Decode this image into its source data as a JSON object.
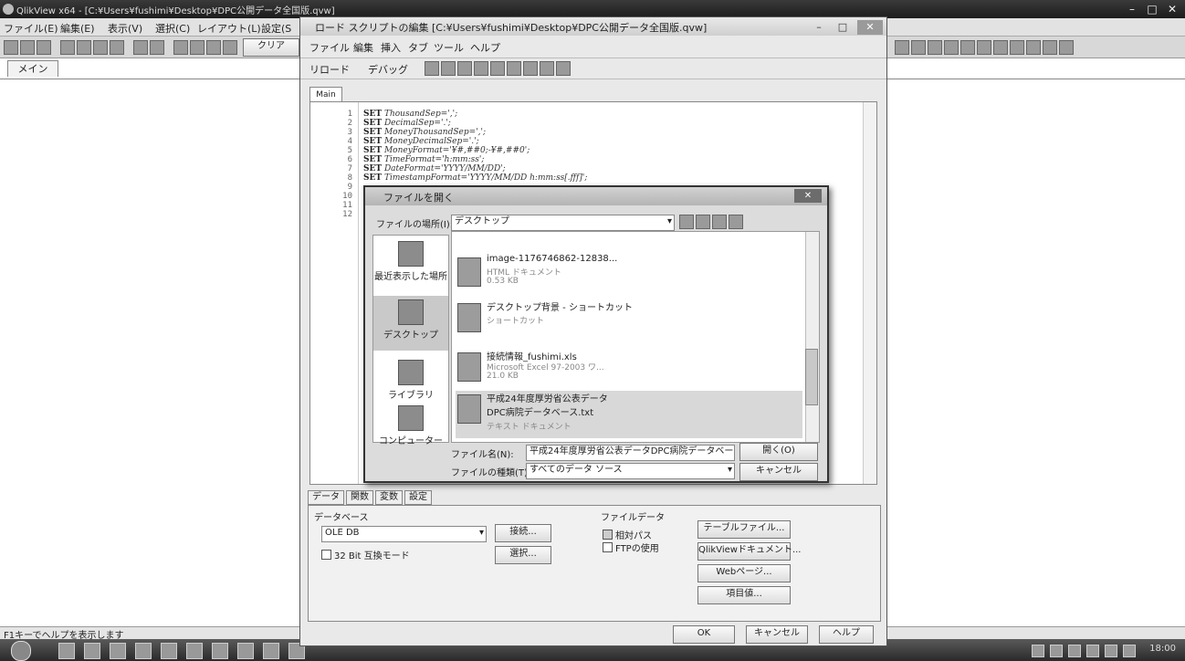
{
  "main_window": {
    "title": "QlikView x64 - [C:¥Users¥fushimi¥Desktop¥DPC公開データ全国版.qvw]",
    "menu": [
      "ファイル(E)",
      "編集(E)",
      "表示(V)",
      "選択(C)",
      "レイアウト(L)",
      "設定(S"
    ],
    "clear_label": "クリア",
    "sheet_tab": "メイン",
    "status_text": "F1キーでヘルプを表示します",
    "clock": "18:00"
  },
  "editor": {
    "title": "ロード スクリプトの編集 [C:¥Users¥fushimi¥Desktop¥DPC公開データ全国版.qvw]",
    "menu": [
      "ファイル",
      "編集",
      "挿入",
      "タブ",
      "ツール",
      "ヘルプ"
    ],
    "reload": "リロード",
    "debug": "デバッグ",
    "tab": "Main",
    "lines": [
      {
        "n": "1",
        "kw": "SET",
        "rest": "ThousandSep=',';"
      },
      {
        "n": "2",
        "kw": "SET",
        "rest": "DecimalSep='.';"
      },
      {
        "n": "3",
        "kw": "SET",
        "rest": "MoneyThousandSep=',';"
      },
      {
        "n": "4",
        "kw": "SET",
        "rest": "MoneyDecimalSep='.';"
      },
      {
        "n": "5",
        "kw": "SET",
        "rest": "MoneyFormat='¥#,##0;-¥#,##0';"
      },
      {
        "n": "6",
        "kw": "SET",
        "rest": "TimeFormat='h:mm:ss';"
      },
      {
        "n": "7",
        "kw": "SET",
        "rest": "DateFormat='YYYY/MM/DD';"
      },
      {
        "n": "8",
        "kw": "SET",
        "rest": "TimestampFormat='YYYY/MM/DD h:mm:ss[.fff]';"
      },
      {
        "n": "9",
        "kw": "",
        "rest": ""
      },
      {
        "n": "10",
        "kw": "",
        "rest": ""
      },
      {
        "n": "11",
        "kw": "",
        "rest": ""
      },
      {
        "n": "12",
        "kw": "",
        "rest": ""
      }
    ],
    "bottom_tabs": [
      "データ",
      "関数",
      "変数",
      "設定"
    ],
    "database_label": "データベース",
    "db_value": "OLE DB",
    "connect": "接続...",
    "select": "選択...",
    "bit32": "32 Bit 互換モード",
    "filedata_label": "ファイルデータ",
    "relative_path": "相対パス",
    "use_ftp": "FTPの使用",
    "table_file": "テーブルファイル...",
    "qv_doc": "QlikViewドキュメント...",
    "web_page": "Webページ...",
    "field_data": "項目値...",
    "ok": "OK",
    "cancel": "キャンセル",
    "help": "ヘルプ"
  },
  "file_dialog": {
    "title": "ファイルを開く",
    "location_label": "ファイルの場所(I):",
    "location_value": "デスクトップ",
    "places": [
      "最近表示した場所",
      "デスクトップ",
      "ライブラリ",
      "コンピューター"
    ],
    "files": [
      {
        "name": "image-1176746862-12838...",
        "type": "HTML ドキュメント",
        "size": "0.53 KB"
      },
      {
        "name": "デスクトップ背景 - ショートカット",
        "type": "ショートカット",
        "size": ""
      },
      {
        "name": "接続情報_fushimi.xls",
        "type": "Microsoft Excel 97-2003 ワ...",
        "size": "21.0 KB"
      },
      {
        "name": "平成24年度厚労省公表データ DPC病院データベース.txt",
        "type": "テキスト ドキュメント",
        "size": ""
      }
    ],
    "filename_label": "ファイル名(N):",
    "filename_value": "平成24年度厚労省公表データDPC病院データベー",
    "filetype_label": "ファイルの種類(T):",
    "filetype_value": "すべてのデータ ソース",
    "open": "開く(O)",
    "cancel": "キャンセル"
  }
}
